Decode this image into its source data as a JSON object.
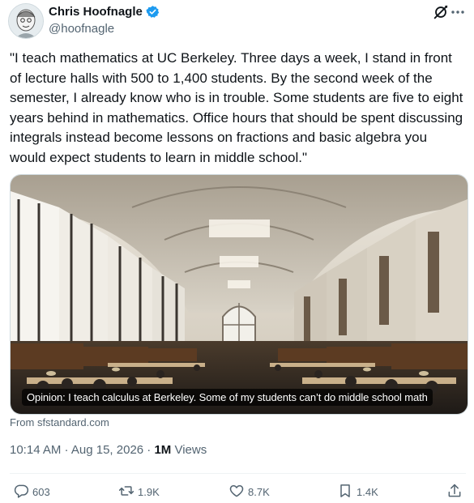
{
  "author": {
    "display_name": "Chris Hoofnagle",
    "handle": "@hoofnagle",
    "verified": true
  },
  "tweet": {
    "text": "\"I teach mathematics at UC Berkeley. Three days a week, I stand in front of lecture halls with 500 to 1,400 students. By the second week of the semester, I already know who is in trouble. Some students are five to eight years behind in mathematics. Office hours that should be spent discussing integrals instead become lessons on fractions and basic algebra you would expect students to learn in middle school.\""
  },
  "card": {
    "caption": "Opinion: I teach calculus at Berkeley. Some of my students can’t do middle school math",
    "source": "From sfstandard.com"
  },
  "meta": {
    "timestamp": "10:14 AM · Aug 15, 2026 · ",
    "views_count": "1M",
    "views_label": " Views"
  },
  "actions": {
    "replies": "603",
    "reposts": "1.9K",
    "likes": "8.7K",
    "bookmarks": "1.4K"
  },
  "icons": [
    "avatar",
    "verified-badge-icon",
    "grok-icon",
    "more-icon",
    "reply-icon",
    "repost-icon",
    "like-icon",
    "bookmark-icon",
    "share-icon"
  ],
  "colors": {
    "verified_blue": "#1d9bf0",
    "secondary_text": "#536471",
    "primary_text": "#0f1419"
  }
}
